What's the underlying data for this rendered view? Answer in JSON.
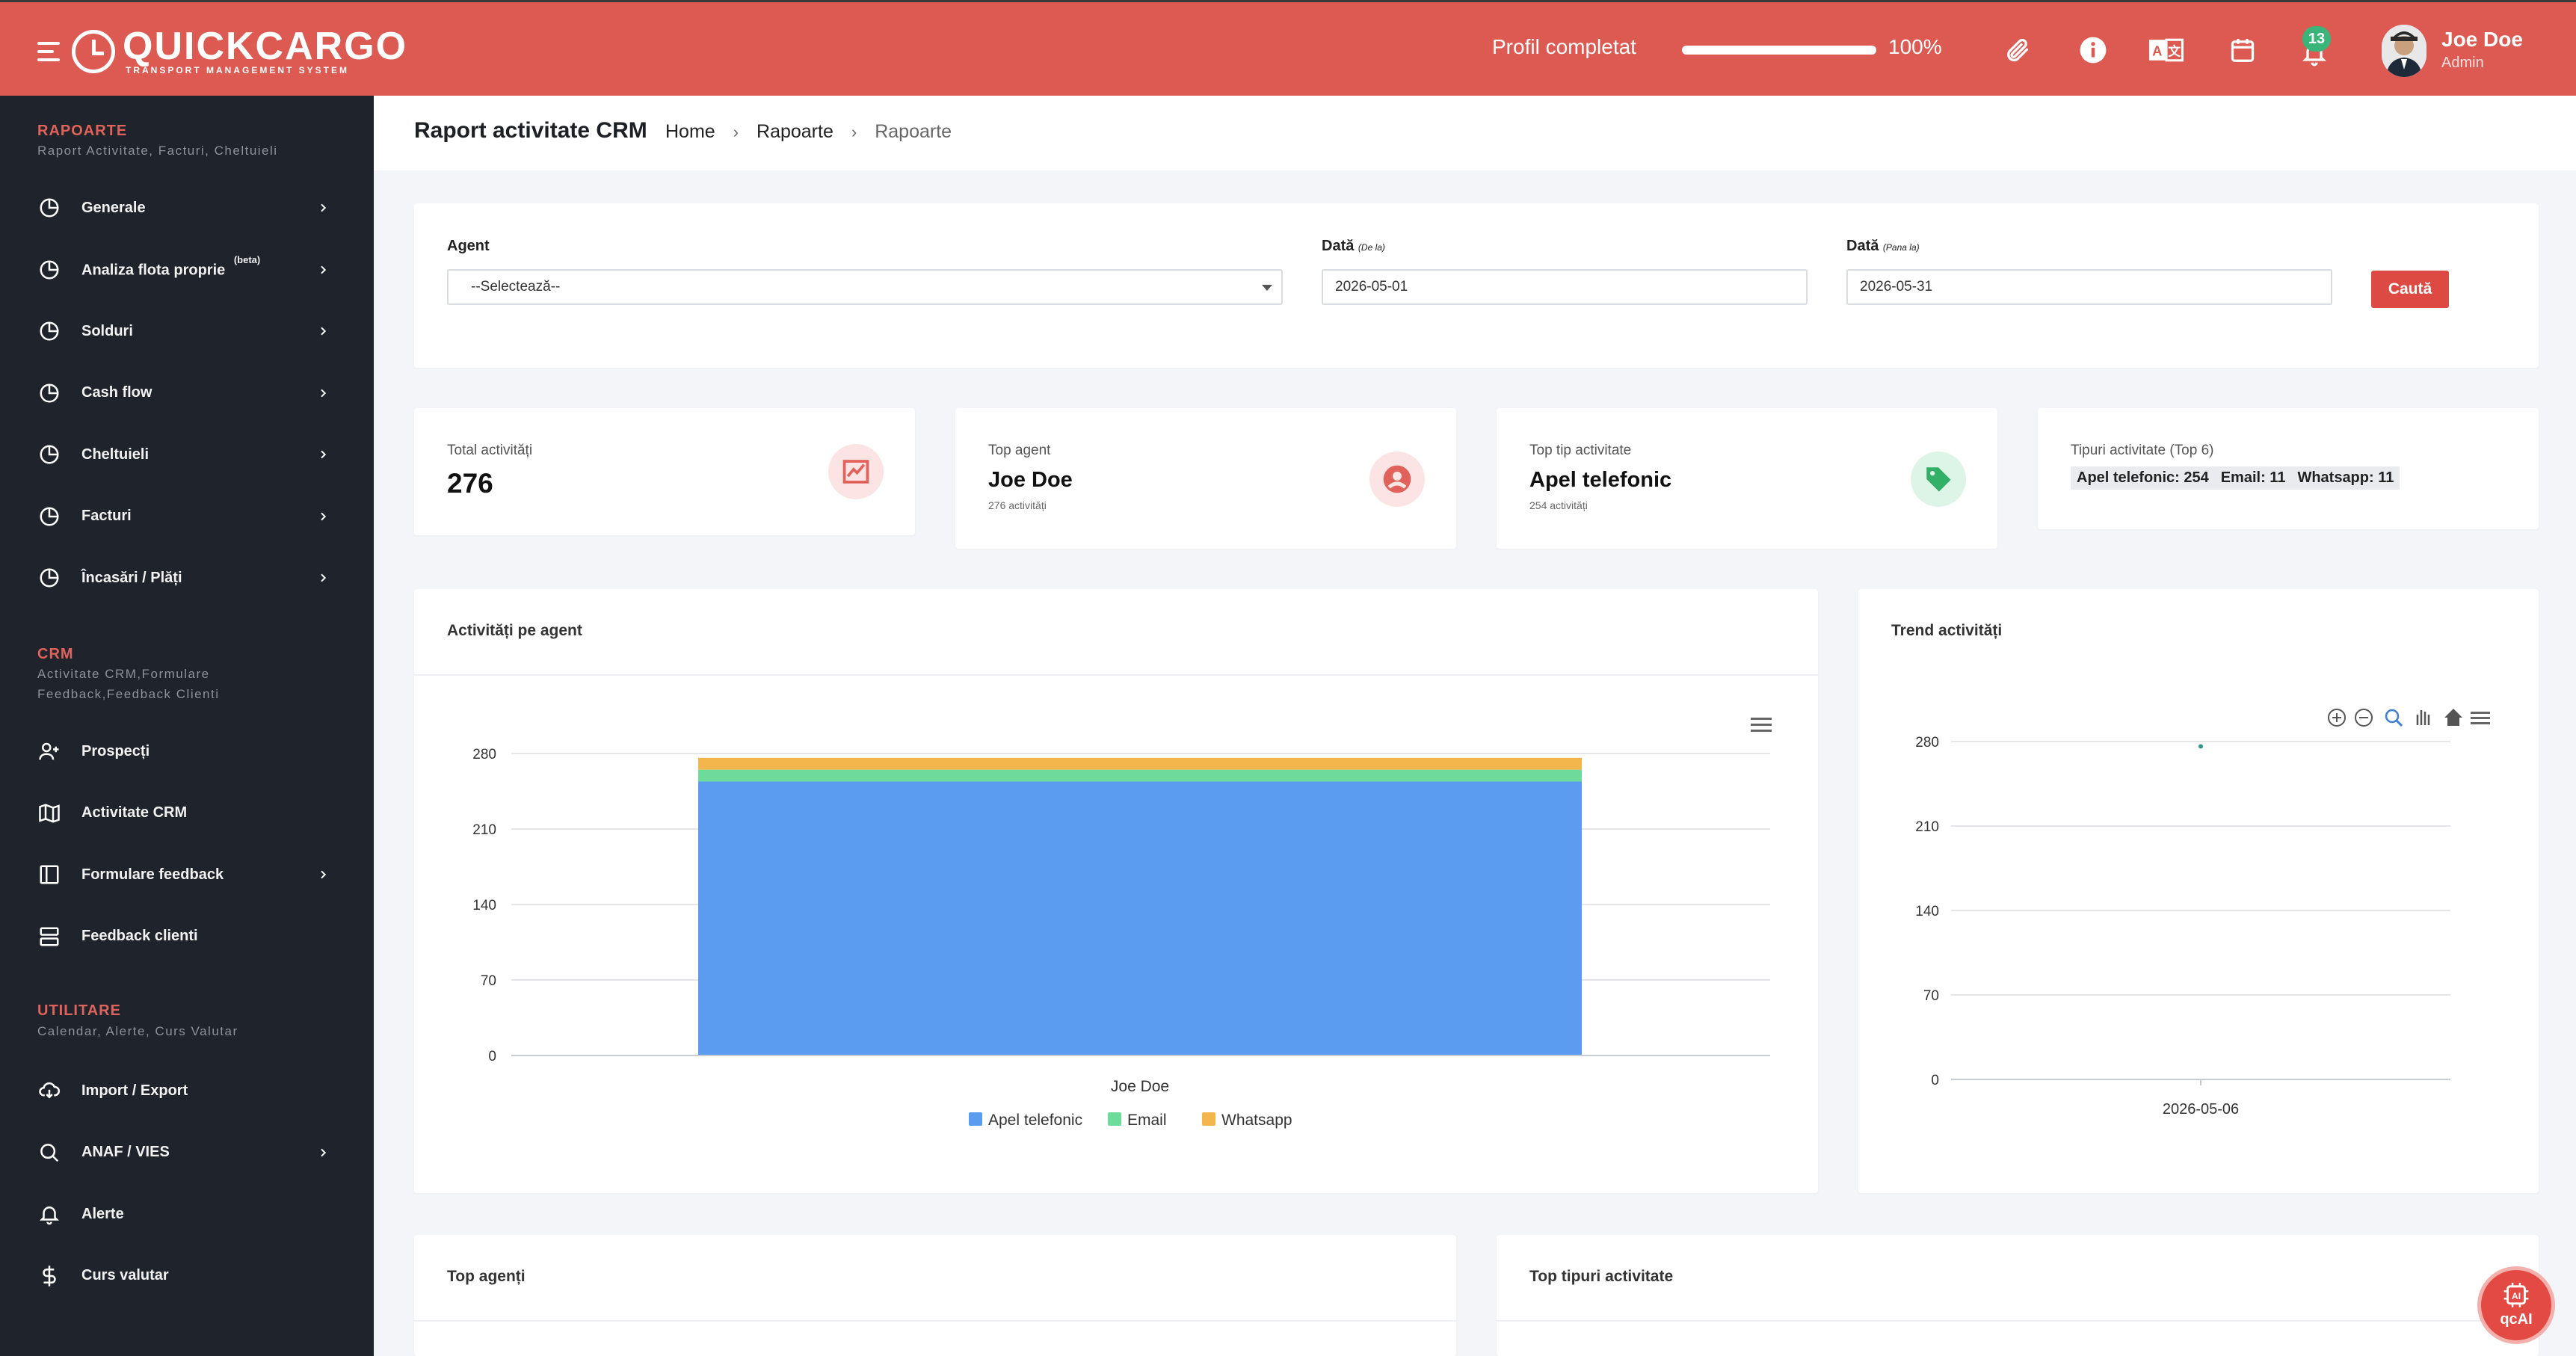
{
  "app": {
    "logo_name": "QUICKCARGO",
    "logo_sub": "TRANSPORT MANAGEMENT SYSTEM",
    "profile_label": "Profil completat",
    "profile_progress_percent": 100,
    "profile_progress_text": "100%",
    "notification_count": "13",
    "user_name": "Joe Doe",
    "user_role": "Admin",
    "accent_color": "#dd5a52",
    "icons": [
      "paperclip-icon",
      "info-icon",
      "translate-icon",
      "calendar-icon",
      "bell-icon"
    ]
  },
  "sidebar": {
    "sections": [
      {
        "title": "RAPOARTE",
        "subtitle": "Raport Activitate, Facturi, Cheltuieli",
        "items": [
          {
            "label": "Generale",
            "icon": "pie-chart-icon",
            "chevron": true
          },
          {
            "label": "Analiza flota proprie",
            "sup": "(beta)",
            "icon": "pie-chart-icon",
            "chevron": true
          },
          {
            "label": "Solduri",
            "icon": "pie-chart-icon",
            "chevron": true
          },
          {
            "label": "Cash flow",
            "icon": "pie-chart-icon",
            "chevron": true
          },
          {
            "label": "Cheltuieli",
            "icon": "pie-chart-icon",
            "chevron": true
          },
          {
            "label": "Facturi",
            "icon": "pie-chart-icon",
            "chevron": true
          },
          {
            "label": "Încasări / Plăți",
            "icon": "pie-chart-icon",
            "chevron": true
          }
        ]
      },
      {
        "title": "CRM",
        "subtitle": "Activitate CRM,Formulare Feedback,Feedback Clienti",
        "items": [
          {
            "label": "Prospecți",
            "icon": "user-plus-icon",
            "chevron": false
          },
          {
            "label": "Activitate CRM",
            "icon": "map-icon",
            "chevron": false
          },
          {
            "label": "Formulare feedback",
            "icon": "sidebar-panel-icon",
            "chevron": true
          },
          {
            "label": "Feedback clienti",
            "icon": "server-icon",
            "chevron": false
          }
        ]
      },
      {
        "title": "UTILITARE",
        "subtitle": "Calendar, Alerte, Curs Valutar",
        "items": [
          {
            "label": "Import / Export",
            "icon": "cloud-download-icon",
            "chevron": false
          },
          {
            "label": "ANAF / VIES",
            "icon": "search-icon",
            "chevron": true
          },
          {
            "label": "Alerte",
            "icon": "bell-icon",
            "chevron": false
          },
          {
            "label": "Curs valutar",
            "icon": "dollar-icon",
            "chevron": false
          }
        ]
      }
    ]
  },
  "page": {
    "title": "Raport activitate CRM",
    "breadcrumb": [
      "Home",
      "Rapoarte",
      "Rapoarte"
    ]
  },
  "filters": {
    "agent_label": "Agent",
    "agent_value": "--Selectează--",
    "date_from_label": "Dată",
    "date_from_hint": "(De la)",
    "date_from_value": "2026-05-01",
    "date_to_label": "Dată",
    "date_to_hint": "(Pana la)",
    "date_to_value": "2026-05-31",
    "search_button": "Caută"
  },
  "stats": {
    "total_label": "Total activități",
    "total_value": "276",
    "top_agent_label": "Top agent",
    "top_agent_value": "Joe Doe",
    "top_agent_sub": "276 activități",
    "top_type_label": "Top tip activitate",
    "top_type_value": "Apel telefonic",
    "top_type_sub": "254 activități",
    "types_label": "Tipuri activitate (Top 6)",
    "types_chips": [
      "Apel telefonic: 254",
      "Email: 11",
      "Whatsapp: 11"
    ]
  },
  "cards": {
    "agent_chart_title": "Activități pe agent",
    "trend_chart_title": "Trend activități",
    "top_agents_title": "Top agenți",
    "top_types_title": "Top tipuri activitate"
  },
  "chart_data": [
    {
      "type": "bar",
      "stacked": true,
      "title": "Activități pe agent",
      "categories": [
        "Joe Doe"
      ],
      "series": [
        {
          "name": "Apel telefonic",
          "values": [
            254
          ],
          "color": "#5b9cf0"
        },
        {
          "name": "Email",
          "values": [
            11
          ],
          "color": "#6ddc9a"
        },
        {
          "name": "Whatsapp",
          "values": [
            11
          ],
          "color": "#f3b64c"
        }
      ],
      "yticks": [
        "0",
        "70",
        "140",
        "210",
        "280"
      ],
      "ylim": [
        0,
        280
      ],
      "legend": "bottom",
      "grid": true
    },
    {
      "type": "line",
      "title": "Trend activități",
      "x": [
        "2026-05-06"
      ],
      "series": [
        {
          "values": [
            276
          ],
          "color": "#2e9a8f"
        }
      ],
      "yticks": [
        "0",
        "70",
        "140",
        "210",
        "280"
      ],
      "ylim": [
        0,
        280
      ],
      "grid": true
    }
  ],
  "fab": {
    "label": "qcAI",
    "icon": "ai-chip-icon"
  }
}
